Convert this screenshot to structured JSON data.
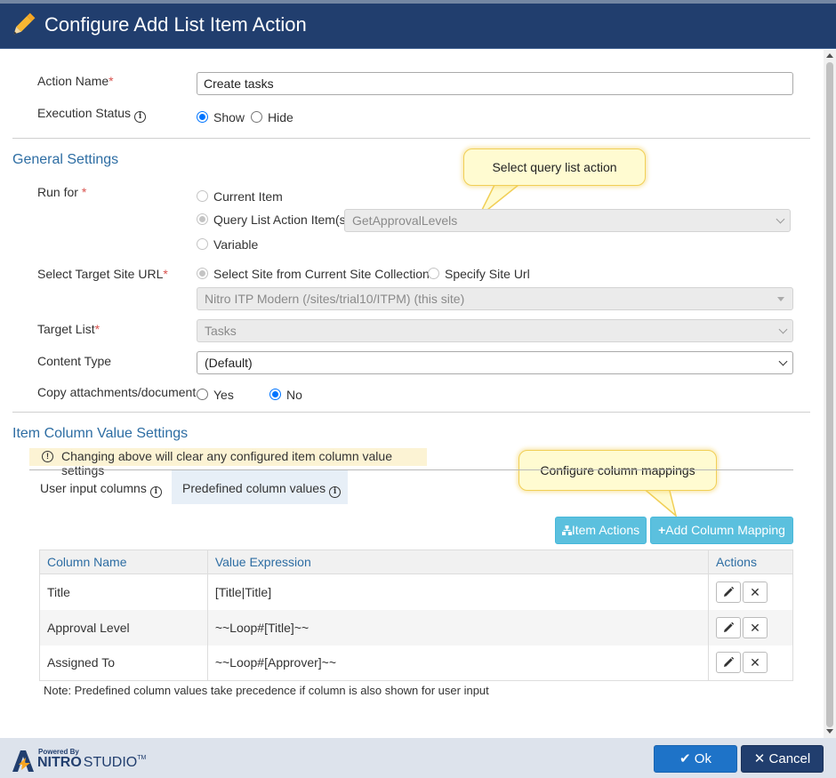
{
  "dialog": {
    "title": "Configure Add List Item Action"
  },
  "action_name": {
    "label": "Action Name",
    "required_mark": "*",
    "value": "Create tasks"
  },
  "execution_status": {
    "label": "Execution Status",
    "options": [
      {
        "label": "Show",
        "checked": true
      },
      {
        "label": "Hide",
        "checked": false
      }
    ]
  },
  "general_settings": {
    "title": "General Settings",
    "run_for": {
      "label": "Run for ",
      "required_mark": "*",
      "options": [
        "Current Item",
        "Query List Action Item(s)",
        "Variable"
      ],
      "selected": "Query List Action Item(s)",
      "query_select_value": "GetApprovalLevels"
    },
    "target_site": {
      "label": "Select Target Site URL",
      "required_mark": "*",
      "options": [
        "Select Site from Current Site Collection",
        "Specify Site Url"
      ],
      "site_value": "Nitro ITP Modern (/sites/trial10/ITPM) (this site)"
    },
    "target_list": {
      "label": "Target List",
      "required_mark": "*",
      "value": "Tasks"
    },
    "content_type": {
      "label": "Content Type",
      "value": "(Default)"
    },
    "copy_attachments": {
      "label": "Copy attachments/document",
      "options": [
        {
          "label": "Yes",
          "checked": false
        },
        {
          "label": "No",
          "checked": true
        }
      ]
    }
  },
  "callouts": {
    "query": "Select query list action",
    "mappings": "Configure column mappings"
  },
  "item_column_settings": {
    "title": "Item Column Value Settings",
    "warning": "Changing above will clear any configured item column value settings",
    "tabs": [
      "User input columns",
      "Predefined column values"
    ],
    "active_tab": "Predefined column values",
    "buttons": {
      "item_actions": "Item Actions",
      "add_mapping": "Add Column Mapping"
    },
    "table": {
      "headers": [
        "Column Name",
        "Value Expression",
        "Actions"
      ],
      "rows": [
        {
          "column": "Title",
          "expression": "[Title|Title]"
        },
        {
          "column": "Approval Level",
          "expression": "~~Loop#[Title]~~"
        },
        {
          "column": "Assigned To",
          "expression": "~~Loop#[Approver]~~"
        }
      ]
    },
    "note": "Note: Predefined column values take precedence if column is also shown for user input"
  },
  "footer": {
    "brand_powered": "Powered By",
    "brand_name": "NITRO",
    "brand_product": "STUDIO",
    "brand_tm": "TM",
    "ok": "Ok",
    "cancel": "Cancel"
  },
  "colors": {
    "header": "#213e6e",
    "accent": "#2d6da3",
    "info_button": "#5bc0de",
    "primary_button": "#1e73c8"
  }
}
